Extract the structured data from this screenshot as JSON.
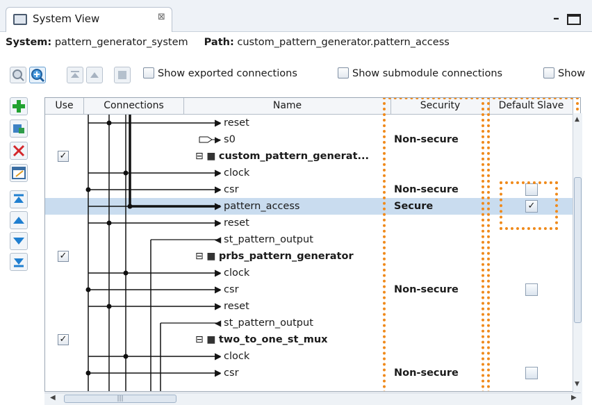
{
  "tab": {
    "title": "System View",
    "close_glyph": "⊠"
  },
  "path": {
    "system_label": "System:",
    "system_value": "pattern_generator_system",
    "path_label": "Path:",
    "path_value": "custom_pattern_generator.pattern_access"
  },
  "toolbar": {
    "opt1": "Show exported connections",
    "opt2": "Show submodule connections",
    "opt3": "Show"
  },
  "columns": {
    "use": "Use",
    "connections": "Connections",
    "name": "Name",
    "security": "Security",
    "default_slave": "Default Slave"
  },
  "rows": [
    {
      "name": "reset",
      "security": "",
      "clip": "R",
      "icon": "in",
      "default": "",
      "use": false
    },
    {
      "name": "s0",
      "security": "Non-secure",
      "clip": "A",
      "icon": "in",
      "default": "",
      "use": false
    },
    {
      "name": "custom_pattern_generat...",
      "security": "",
      "clip": "C",
      "icon": "module",
      "default": "",
      "use": true
    },
    {
      "name": "clock",
      "security": "",
      "clip": "C",
      "icon": "in",
      "default": "",
      "use": false
    },
    {
      "name": "csr",
      "security": "Non-secure",
      "clip": "A",
      "icon": "in",
      "default": "unchecked",
      "use": false
    },
    {
      "name": "pattern_access",
      "security": "Secure",
      "clip": "A",
      "icon": "in",
      "default": "checked",
      "use": false
    },
    {
      "name": "reset",
      "security": "",
      "clip": "R",
      "icon": "in",
      "default": "",
      "use": false
    },
    {
      "name": "st_pattern_output",
      "security": "",
      "clip": "A",
      "icon": "out",
      "default": "",
      "use": false
    },
    {
      "name": "prbs_pattern_generator",
      "security": "",
      "clip": "P",
      "icon": "module",
      "default": "",
      "use": true
    },
    {
      "name": "clock",
      "security": "",
      "clip": "C",
      "icon": "in",
      "default": "",
      "use": false
    },
    {
      "name": "csr",
      "security": "Non-secure",
      "clip": "A",
      "icon": "in",
      "default": "unchecked",
      "use": false
    },
    {
      "name": "reset",
      "security": "",
      "clip": "R",
      "icon": "in",
      "default": "",
      "use": false
    },
    {
      "name": "st_pattern_output",
      "security": "",
      "clip": "A",
      "icon": "out",
      "default": "",
      "use": false
    },
    {
      "name": "two_to_one_st_mux",
      "security": "",
      "clip": "T",
      "icon": "module",
      "default": "",
      "use": true
    },
    {
      "name": "clock",
      "security": "",
      "clip": "C",
      "icon": "in",
      "default": "",
      "use": false
    },
    {
      "name": "csr",
      "security": "Non-secure",
      "clip": "A",
      "icon": "in",
      "default": "unchecked",
      "use": false
    }
  ],
  "use_check_glyph": "✓",
  "default_check_glyph": "✓",
  "scroll": {
    "hthumb": "|||"
  },
  "icons": [
    "system-view-icon",
    "zoom-out-icon",
    "zoom-in-icon",
    "move-top-icon",
    "move-up-icon",
    "filter-icon",
    "add-icon",
    "remove-icon",
    "edit-icon"
  ],
  "colors": {
    "accent_orange": "#f08a1b",
    "selection": "#c9dcef",
    "toolbar_bg": "#eef2f7"
  }
}
